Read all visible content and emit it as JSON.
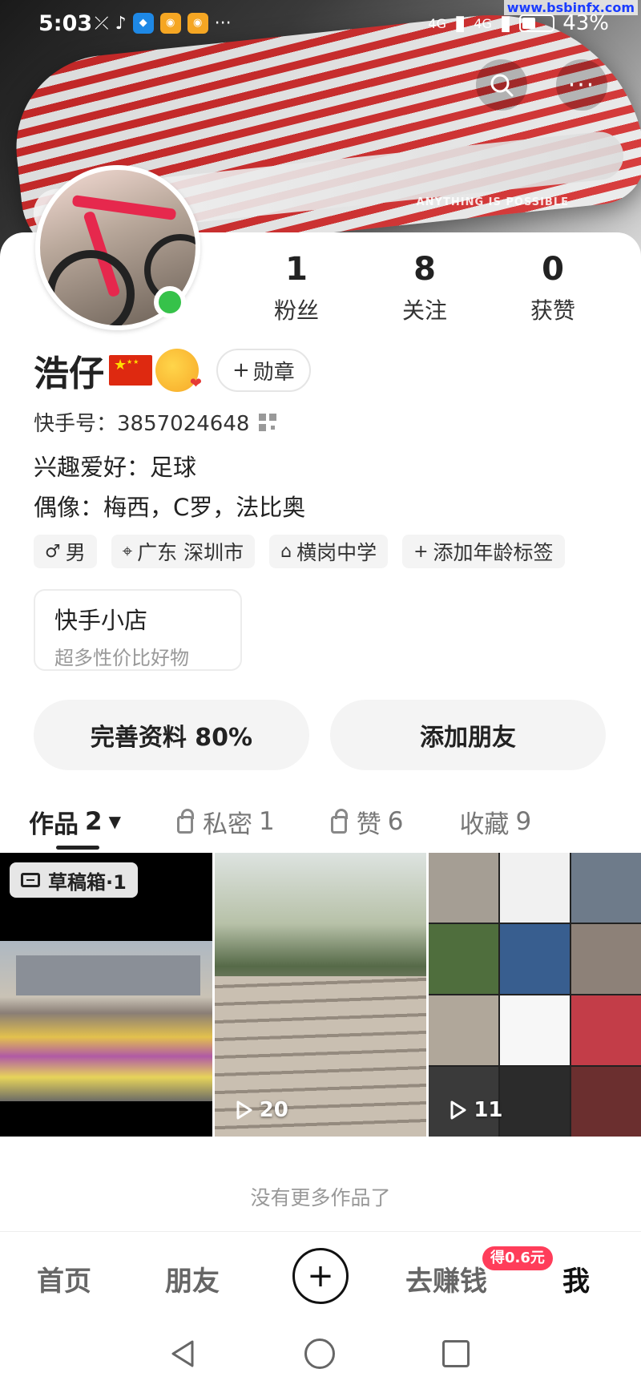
{
  "status_bar": {
    "time": "5:03",
    "signal1": "4G",
    "signal2": "4G",
    "battery": "43%",
    "watermark": "www.bsbinfx.com"
  },
  "header": {
    "search_icon": "search-icon",
    "more_icon": "more-icon",
    "banner_text": "ANYTHING IS POSSIBLE"
  },
  "profile": {
    "name": "浩仔",
    "stats": [
      {
        "num": "1",
        "label": "粉丝"
      },
      {
        "num": "8",
        "label": "关注"
      },
      {
        "num": "0",
        "label": "获赞"
      }
    ],
    "badge_button": "勋章",
    "kuaishou_id": "快手号：3857024648",
    "hobby": "兴趣爱好：足球",
    "idol": "偶像：梅西，C罗，法比奥",
    "tags": [
      {
        "icon": "♂",
        "label": "男"
      },
      {
        "icon": "⌖",
        "label": "广东 深圳市"
      },
      {
        "icon": "🎓",
        "label": "横岗中学"
      },
      {
        "icon": "+",
        "label": "添加年龄标签"
      }
    ],
    "shop": {
      "title": "快手小店",
      "subtitle": "超多性价比好物"
    },
    "complete_profile": "完善资料 80%",
    "add_friend": "添加朋友"
  },
  "tabs": [
    {
      "label": "作品",
      "count": "2",
      "active": true
    },
    {
      "label": "私密",
      "count": "1",
      "locked": true
    },
    {
      "label": "赞",
      "count": "6",
      "locked": true
    },
    {
      "label": "收藏",
      "count": "9"
    }
  ],
  "works": {
    "draft_label": "草稿箱·1",
    "plays_2": "20",
    "plays_3": "11",
    "no_more": "没有更多作品了"
  },
  "bottom_nav": {
    "home": "首页",
    "friends": "朋友",
    "earn": "去赚钱",
    "earn_badge": "得0.6元",
    "me": "我"
  },
  "colors": {
    "online": "#36c24a",
    "earn_badge": "#ff3d5a"
  }
}
